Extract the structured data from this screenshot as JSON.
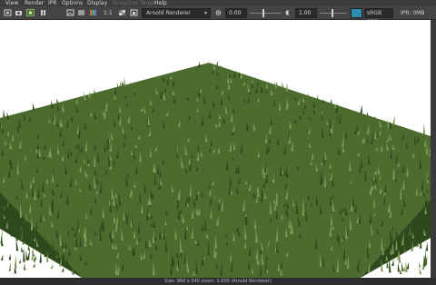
{
  "menu": {
    "items": [
      {
        "label": "View",
        "enabled": true
      },
      {
        "label": "Render",
        "enabled": true
      },
      {
        "label": "IPR",
        "enabled": true
      },
      {
        "label": "Options",
        "enabled": true
      },
      {
        "label": "Display",
        "enabled": true
      },
      {
        "label": "Snapshot Target",
        "enabled": false
      },
      {
        "label": "Help",
        "enabled": true
      }
    ]
  },
  "toolbar": {
    "icons": [
      "render-frame-icon",
      "snapshot-icon",
      "ipr-render-icon",
      "pause-ipr-icon",
      "keep-image-icon",
      "remove-image-icon",
      "rgb-channels-icon",
      "alpha-channel-icon"
    ],
    "ratio_label": "1:1",
    "renderer": "Arnold Renderer",
    "exposure_value": "0.00",
    "gamma_value": "1.00",
    "color_space": "sRGB gam",
    "ipr_label": "IPR: 0MB",
    "accent_color": "#2a8fb0"
  },
  "viewport": {
    "background": "#ffffff",
    "grass_dark": "#2e4a1c",
    "grass_mid": "#4c6b2f",
    "grass_light": "#7f9a5a"
  },
  "status": {
    "text": "Size: 960 x 540  zoom: 1.000      (Arnold Renderer)"
  }
}
